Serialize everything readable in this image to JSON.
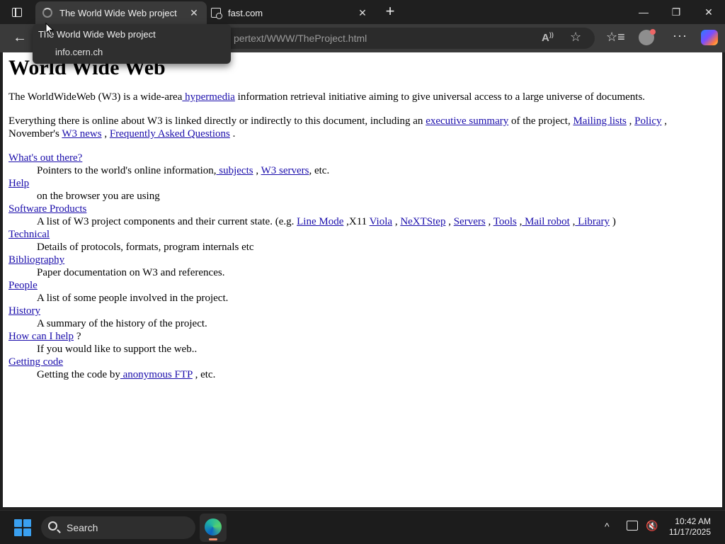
{
  "browser": {
    "tabs": [
      {
        "label": "The World Wide Web project",
        "active": true,
        "icon": "loading-spinner-icon"
      },
      {
        "label": "fast.com",
        "active": false,
        "icon": "page-icon"
      }
    ],
    "new_tab_symbol": "+",
    "tooltip": {
      "title": "The World Wide Web project",
      "domain": "info.cern.ch"
    },
    "address_bar": {
      "url_visible": "pertext/WWW/TheProject.html"
    },
    "toolbar_icons": [
      "back-icon",
      "read-aloud-icon",
      "favorite-star-icon",
      "favorites-icon",
      "profile-icon",
      "more-icon",
      "copilot-icon"
    ]
  },
  "page": {
    "heading": "World Wide Web",
    "intro": {
      "before": "The WorldWideWeb (W3) is a wide-area",
      "link": " hypermedia",
      "after": " information retrieval initiative aiming to give universal access to a large universe of documents."
    },
    "para2": {
      "t1": "Everything there is online about W3 is linked directly or indirectly to this document, including an ",
      "l1": "executive summary",
      "t2": " of the project, ",
      "l2": "Mailing lists",
      "t3": " , ",
      "l3": "Policy",
      "t4": " , November's ",
      "l4": "W3 news",
      "t5": " , ",
      "l5": "Frequently Asked Questions",
      "t6": " ."
    },
    "sections": [
      {
        "title": "What's out there?",
        "desc_before": "Pointers to the world's online information,",
        "links": [
          " subjects",
          "W3 servers"
        ],
        "sep": " , ",
        "desc_after": ", etc."
      },
      {
        "title": "Help",
        "desc": "on the browser you are using"
      },
      {
        "title": "Software Products",
        "desc_before": "A list of W3 project components and their current state. (e.g. ",
        "links": [
          "Line Mode",
          "Viola",
          "NeXTStep",
          "Servers",
          "Tools",
          " Mail robot",
          " Library"
        ],
        "x11": " ,X11 ",
        "desc_after": " )"
      },
      {
        "title": "Technical",
        "desc": "Details of protocols, formats, program internals etc"
      },
      {
        "title": "Bibliography",
        "desc": "Paper documentation on W3 and references."
      },
      {
        "title": "People",
        "desc": "A list of some people involved in the project."
      },
      {
        "title": "History",
        "desc": "A summary of the history of the project."
      },
      {
        "title": "How can I help",
        "title_suffix": " ?",
        "desc": "If you would like to support the web.."
      },
      {
        "title": "Getting code",
        "desc_before": "Getting the code by",
        "link": " anonymous FTP",
        "desc_after": " , etc."
      }
    ]
  },
  "taskbar": {
    "search_label": "Search",
    "time": "10:42 AM",
    "date": "11/17/2025",
    "tray_up_symbol": "^"
  },
  "colors": {
    "link": "#1a0dab",
    "chrome_bg": "#1f1f1f",
    "toolbar_bg": "#3a3a3a",
    "start_blue": "#3aa0f0"
  }
}
